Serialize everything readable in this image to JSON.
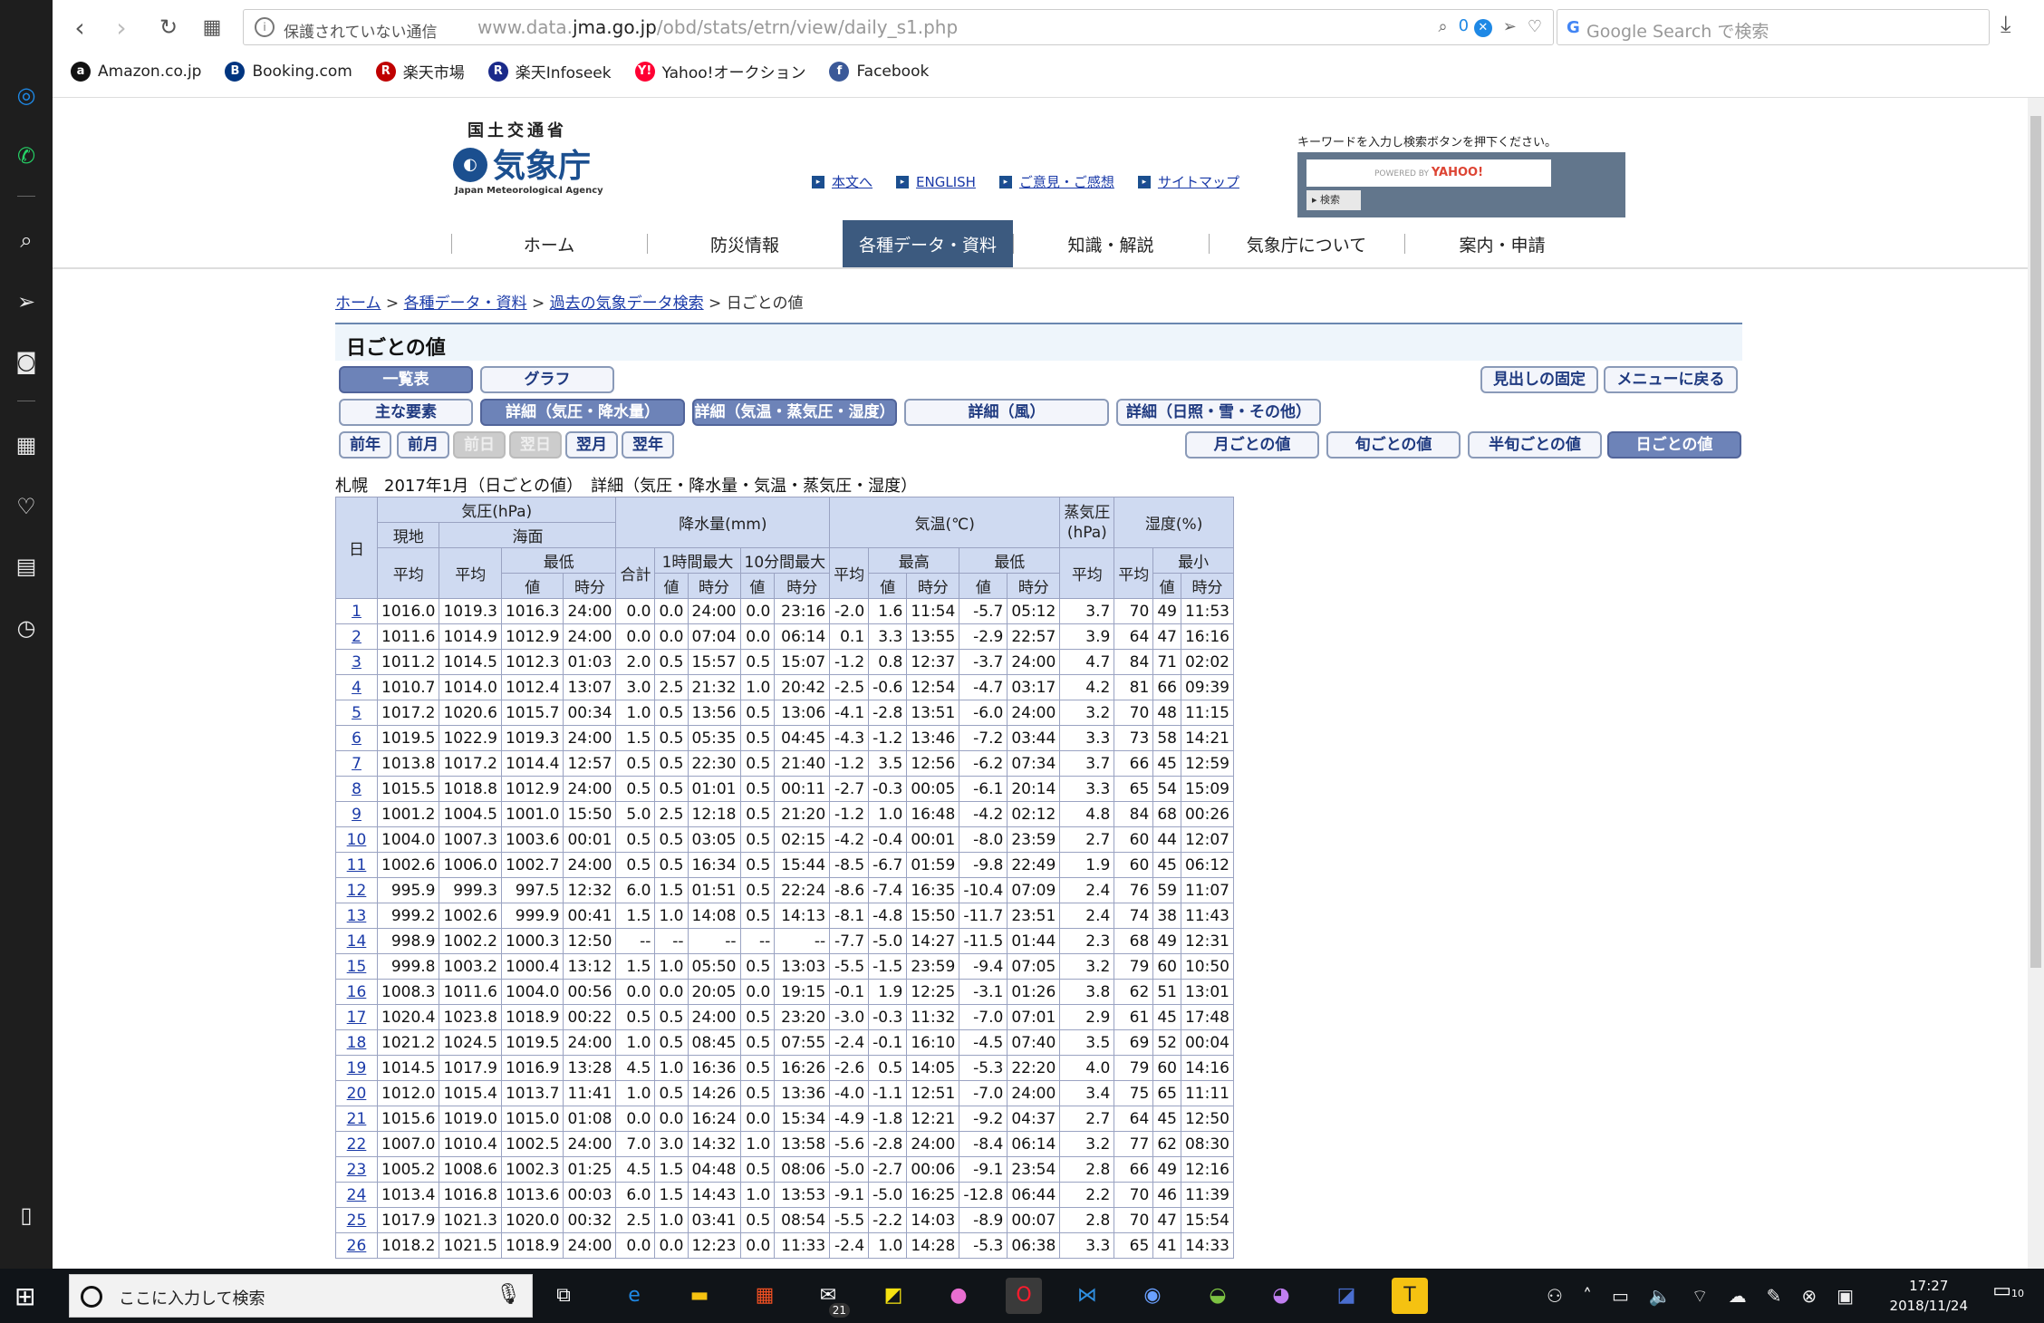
{
  "browser": {
    "insecure_label": "保護されていない通信",
    "url_host": "www.data.",
    "url_domain": "jma.go.jp",
    "url_path": "/obd/stats/etrn/view/daily_s1.php",
    "block_counter": "0",
    "search_placeholder": "Google Search で検索",
    "bookmarks": [
      {
        "label": "Amazon.co.jp",
        "icon": "amazon-icon",
        "color": "#111111",
        "glyph": "a"
      },
      {
        "label": "Booking.com",
        "icon": "booking-icon",
        "color": "#003580",
        "glyph": "B"
      },
      {
        "label": "楽天市場",
        "icon": "rakuten-icon",
        "color": "#bf0000",
        "glyph": "R"
      },
      {
        "label": "楽天Infoseek",
        "icon": "infoseek-icon",
        "color": "#1a2a8a",
        "glyph": "R"
      },
      {
        "label": "Yahoo!オークション",
        "icon": "yahoo-auction-icon",
        "color": "#ff0033",
        "glyph": "Y!"
      },
      {
        "label": "Facebook",
        "icon": "facebook-icon",
        "color": "#3b5998",
        "glyph": "f"
      }
    ]
  },
  "site": {
    "ministry": "国土交通省",
    "name": "気象庁",
    "name_en": "Japan Meteorological Agency",
    "top_links": [
      "本文へ",
      "ENGLISH",
      "ご意見・ご感想",
      "サイトマップ"
    ],
    "search_hint": "キーワードを入力し検索ボタンを押下ください。",
    "search_powered": "POWERED BY",
    "search_yahoo": "YAHOO!",
    "search_button": "検索",
    "nav": [
      "ホーム",
      "防災情報",
      "各種データ・資料",
      "知識・解説",
      "気象庁について",
      "案内・申請"
    ],
    "nav_active_index": 2
  },
  "breadcrumb": {
    "home": "ホーム",
    "data": "各種データ・資料",
    "past": "過去の気象データ検索",
    "current": "日ごとの値"
  },
  "title": "日ごとの値",
  "buttons": {
    "list": "一覧表",
    "graph": "グラフ",
    "fix_header": "見出しの固定",
    "back_menu": "メニューに戻る",
    "main": "主な要素",
    "detail_pressure": "詳細（気圧・降水量）",
    "detail_temp": "詳細（気温・蒸気圧・湿度）",
    "detail_wind": "詳細（風）",
    "detail_sun": "詳細（日照・雪・その他）",
    "prev_year": "前年",
    "prev_month": "前月",
    "prev_day": "前日",
    "next_day": "翌日",
    "next_month": "翌月",
    "next_year": "翌年",
    "monthly": "月ごとの値",
    "dekad": "旬ごとの値",
    "pentad": "半旬ごとの値",
    "daily": "日ごとの値"
  },
  "caption": "札幌　2017年1月（日ごとの値）　詳細（気圧・降水量・気温・蒸気圧・湿度）",
  "table": {
    "h_day": "日",
    "h_pressure": "気圧(hPa)",
    "h_station": "現地",
    "h_sea": "海面",
    "h_avg": "平均",
    "h_min": "最低",
    "h_max": "最高",
    "h_minimum": "最小",
    "h_value": "値",
    "h_time": "時分",
    "h_precip": "降水量(mm)",
    "h_total": "合計",
    "h_1h": "1時間最大",
    "h_10m": "10分間最大",
    "h_temp": "気温(℃)",
    "h_vapor": "蒸気圧\n(hPa)",
    "h_humid": "湿度(%)",
    "rows": [
      [
        "1",
        "1016.0",
        "1019.3",
        "1016.3",
        "24:00",
        "0.0",
        "0.0",
        "24:00",
        "0.0",
        "23:16",
        "-2.0",
        "1.6",
        "11:54",
        "-5.7",
        "05:12",
        "3.7",
        "70",
        "49",
        "11:53"
      ],
      [
        "2",
        "1011.6",
        "1014.9",
        "1012.9",
        "24:00",
        "0.0",
        "0.0",
        "07:04",
        "0.0",
        "06:14",
        "0.1",
        "3.3",
        "13:55",
        "-2.9",
        "22:57",
        "3.9",
        "64",
        "47",
        "16:16"
      ],
      [
        "3",
        "1011.2",
        "1014.5",
        "1012.3",
        "01:03",
        "2.0",
        "0.5",
        "15:57",
        "0.5",
        "15:07",
        "-1.2",
        "0.8",
        "12:37",
        "-3.7",
        "24:00",
        "4.7",
        "84",
        "71",
        "02:02"
      ],
      [
        "4",
        "1010.7",
        "1014.0",
        "1012.4",
        "13:07",
        "3.0",
        "2.5",
        "21:32",
        "1.0",
        "20:42",
        "-2.5",
        "-0.6",
        "12:54",
        "-4.7",
        "03:17",
        "4.2",
        "81",
        "66",
        "09:39"
      ],
      [
        "5",
        "1017.2",
        "1020.6",
        "1015.7",
        "00:34",
        "1.0",
        "0.5",
        "13:56",
        "0.5",
        "13:06",
        "-4.1",
        "-2.8",
        "13:51",
        "-6.0",
        "24:00",
        "3.2",
        "70",
        "48",
        "11:15"
      ],
      [
        "6",
        "1019.5",
        "1022.9",
        "1019.3",
        "24:00",
        "1.5",
        "0.5",
        "05:35",
        "0.5",
        "04:45",
        "-4.3",
        "-1.2",
        "13:46",
        "-7.2",
        "03:44",
        "3.3",
        "73",
        "58",
        "14:21"
      ],
      [
        "7",
        "1013.8",
        "1017.2",
        "1014.4",
        "12:57",
        "0.5",
        "0.5",
        "22:30",
        "0.5",
        "21:40",
        "-1.2",
        "3.5",
        "12:56",
        "-6.2",
        "07:34",
        "3.7",
        "66",
        "45",
        "12:59"
      ],
      [
        "8",
        "1015.5",
        "1018.8",
        "1012.9",
        "24:00",
        "0.5",
        "0.5",
        "01:01",
        "0.5",
        "00:11",
        "-2.7",
        "-0.3",
        "00:05",
        "-6.1",
        "20:14",
        "3.3",
        "65",
        "54",
        "15:09"
      ],
      [
        "9",
        "1001.2",
        "1004.5",
        "1001.0",
        "15:50",
        "5.0",
        "2.5",
        "12:18",
        "0.5",
        "21:20",
        "-1.2",
        "1.0",
        "16:48",
        "-4.2",
        "02:12",
        "4.8",
        "84",
        "68",
        "00:26"
      ],
      [
        "10",
        "1004.0",
        "1007.3",
        "1003.6",
        "00:01",
        "0.5",
        "0.5",
        "03:05",
        "0.5",
        "02:15",
        "-4.2",
        "-0.4",
        "00:01",
        "-8.0",
        "23:59",
        "2.7",
        "60",
        "44",
        "12:07"
      ],
      [
        "11",
        "1002.6",
        "1006.0",
        "1002.7",
        "24:00",
        "0.5",
        "0.5",
        "16:34",
        "0.5",
        "15:44",
        "-8.5",
        "-6.7",
        "01:59",
        "-9.8",
        "22:49",
        "1.9",
        "60",
        "45",
        "06:12"
      ],
      [
        "12",
        "995.9",
        "999.3",
        "997.5",
        "12:32",
        "6.0",
        "1.5",
        "01:51",
        "0.5",
        "22:24",
        "-8.6",
        "-7.4",
        "16:35",
        "-10.4",
        "07:09",
        "2.4",
        "76",
        "59",
        "11:07"
      ],
      [
        "13",
        "999.2",
        "1002.6",
        "999.9",
        "00:41",
        "1.5",
        "1.0",
        "14:08",
        "0.5",
        "14:13",
        "-8.1",
        "-4.8",
        "15:50",
        "-11.7",
        "23:51",
        "2.4",
        "74",
        "38",
        "11:43"
      ],
      [
        "14",
        "998.9",
        "1002.2",
        "1000.3",
        "12:50",
        "--",
        "--",
        "--",
        "--",
        "--",
        "-7.7",
        "-5.0",
        "14:27",
        "-11.5",
        "01:44",
        "2.3",
        "68",
        "49",
        "12:31"
      ],
      [
        "15",
        "999.8",
        "1003.2",
        "1000.4",
        "13:12",
        "1.5",
        "1.0",
        "05:50",
        "0.5",
        "13:03",
        "-5.5",
        "-1.5",
        "23:59",
        "-9.4",
        "07:05",
        "3.2",
        "79",
        "60",
        "10:50"
      ],
      [
        "16",
        "1008.3",
        "1011.6",
        "1004.0",
        "00:56",
        "0.0",
        "0.0",
        "20:05",
        "0.0",
        "19:15",
        "-0.1",
        "1.9",
        "12:25",
        "-3.1",
        "01:26",
        "3.8",
        "62",
        "51",
        "13:01"
      ],
      [
        "17",
        "1020.4",
        "1023.8",
        "1018.9",
        "00:22",
        "0.5",
        "0.5",
        "24:00",
        "0.5",
        "23:20",
        "-3.0",
        "-0.3",
        "11:32",
        "-7.0",
        "07:01",
        "2.9",
        "61",
        "45",
        "17:48"
      ],
      [
        "18",
        "1021.2",
        "1024.5",
        "1019.5",
        "24:00",
        "1.0",
        "0.5",
        "08:45",
        "0.5",
        "07:55",
        "-2.4",
        "-0.1",
        "16:10",
        "-4.5",
        "07:40",
        "3.5",
        "69",
        "52",
        "00:04"
      ],
      [
        "19",
        "1014.5",
        "1017.9",
        "1016.9",
        "13:28",
        "4.5",
        "1.0",
        "16:36",
        "0.5",
        "16:26",
        "-2.6",
        "0.5",
        "14:05",
        "-5.3",
        "22:20",
        "4.0",
        "79",
        "60",
        "14:16"
      ],
      [
        "20",
        "1012.0",
        "1015.4",
        "1013.7",
        "11:41",
        "1.0",
        "0.5",
        "14:26",
        "0.5",
        "13:36",
        "-4.0",
        "-1.1",
        "12:51",
        "-7.0",
        "24:00",
        "3.4",
        "75",
        "65",
        "11:11"
      ],
      [
        "21",
        "1015.6",
        "1019.0",
        "1015.0",
        "01:08",
        "0.0",
        "0.0",
        "16:24",
        "0.0",
        "15:34",
        "-4.9",
        "-1.8",
        "12:21",
        "-9.2",
        "04:37",
        "2.7",
        "64",
        "45",
        "12:50"
      ],
      [
        "22",
        "1007.0",
        "1010.4",
        "1002.5",
        "24:00",
        "7.0",
        "3.0",
        "14:32",
        "1.0",
        "13:58",
        "-5.6",
        "-2.8",
        "24:00",
        "-8.4",
        "06:14",
        "3.2",
        "77",
        "62",
        "08:30"
      ],
      [
        "23",
        "1005.2",
        "1008.6",
        "1002.3",
        "01:25",
        "4.5",
        "1.5",
        "04:48",
        "0.5",
        "08:06",
        "-5.0",
        "-2.7",
        "00:06",
        "-9.1",
        "23:54",
        "2.8",
        "66",
        "49",
        "12:16"
      ],
      [
        "24",
        "1013.4",
        "1016.8",
        "1013.6",
        "00:03",
        "6.0",
        "1.5",
        "14:43",
        "1.0",
        "13:53",
        "-9.1",
        "-5.0",
        "16:25",
        "-12.8",
        "06:44",
        "2.2",
        "70",
        "46",
        "11:39"
      ],
      [
        "25",
        "1017.9",
        "1021.3",
        "1020.0",
        "00:32",
        "2.5",
        "1.0",
        "03:41",
        "0.5",
        "08:54",
        "-5.5",
        "-2.2",
        "14:03",
        "-8.9",
        "00:07",
        "2.8",
        "70",
        "47",
        "15:54"
      ],
      [
        "26",
        "1018.2",
        "1021.5",
        "1018.9",
        "24:00",
        "0.0",
        "0.0",
        "12:23",
        "0.0",
        "11:33",
        "-2.4",
        "1.0",
        "14:28",
        "-5.3",
        "06:38",
        "3.3",
        "65",
        "41",
        "14:33"
      ]
    ]
  },
  "taskbar": {
    "search_placeholder": "ここに入力して検索",
    "mail_badge": "21",
    "time": "17:27",
    "date": "2018/11/24",
    "notif_count": "10"
  }
}
